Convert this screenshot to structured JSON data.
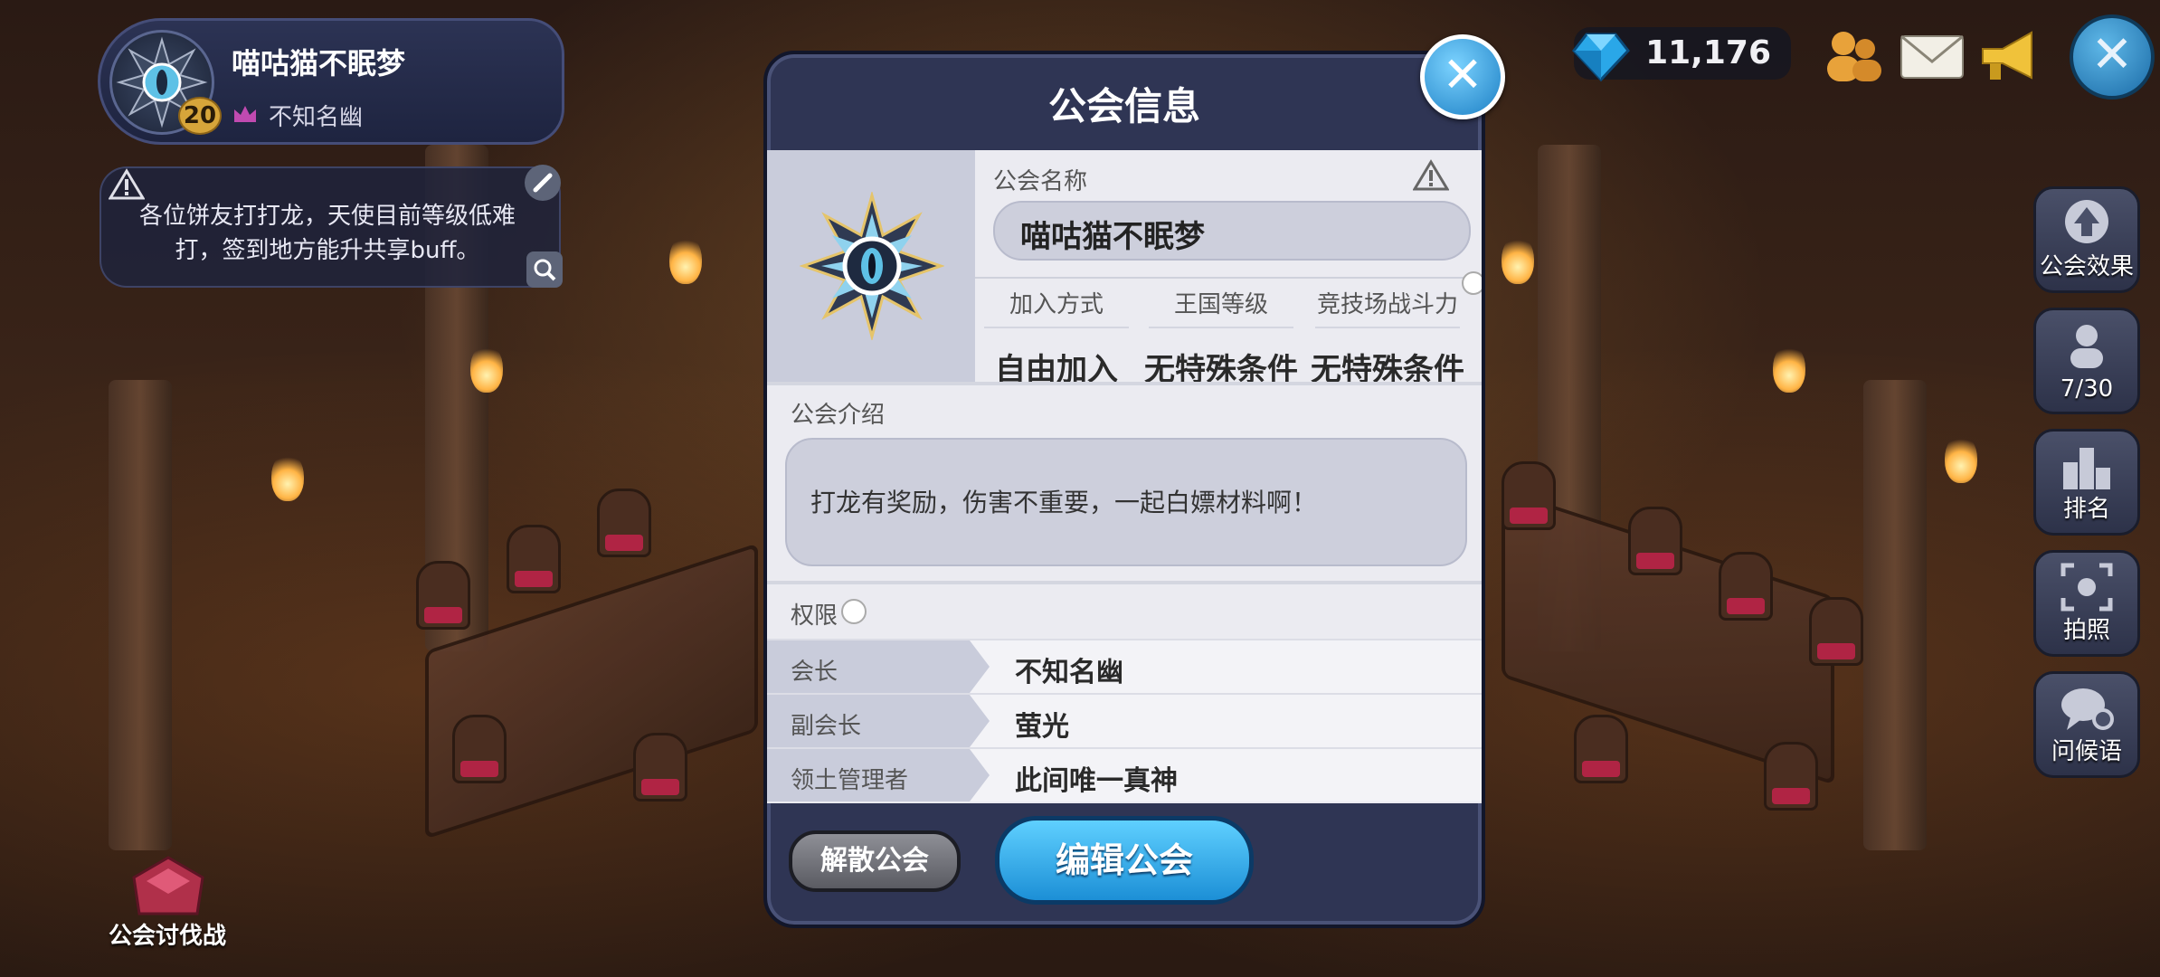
{
  "profile": {
    "name": "喵咕猫不眠梦",
    "level": "20",
    "subtitle": "不知名幽"
  },
  "notice": {
    "text": "各位饼友打打龙，天使目前等级低难打，签到地方能升共享buff。"
  },
  "currency": {
    "value": "11,176",
    "icon": "diamond-icon"
  },
  "top_icons": [
    "members-icon",
    "mail-icon",
    "megaphone-icon",
    "close-icon"
  ],
  "side_menu": [
    {
      "label": "公会效果",
      "icon": "guild-effect-icon"
    },
    {
      "label": "7/30",
      "icon": "member-icon"
    },
    {
      "label": "排名",
      "icon": "ranking-icon"
    },
    {
      "label": "拍照",
      "icon": "camera-icon"
    },
    {
      "label": "问候语",
      "icon": "greeting-icon"
    }
  ],
  "bottom_left": {
    "label": "公会讨伐战",
    "icon": "guild-raid-icon"
  },
  "dialog": {
    "title": "公会信息",
    "name_label": "公会名称",
    "name_value": "喵咕猫不眠梦",
    "attrs": [
      {
        "head": "加入方式",
        "value": "自由加入"
      },
      {
        "head": "王国等级",
        "value": "无特殊条件"
      },
      {
        "head": "竞技场战斗力",
        "value": "无特殊条件"
      }
    ],
    "intro_label": "公会介绍",
    "intro_text": "打龙有奖励，伤害不重要，一起白嫖材料啊！",
    "perm_label": "权限",
    "permissions": [
      {
        "role": "会长",
        "name": "不知名幽"
      },
      {
        "role": "副会长",
        "name": "萤光"
      },
      {
        "role": "领土管理者",
        "name": "此间唯一真神"
      }
    ],
    "disband_label": "解散公会",
    "edit_label": "编辑公会"
  },
  "colors": {
    "dialog_bg": "#2f3554",
    "content_bg": "#ebebf1",
    "accent_blue": "#1c8fd6",
    "gem": "#2aa7e8"
  }
}
